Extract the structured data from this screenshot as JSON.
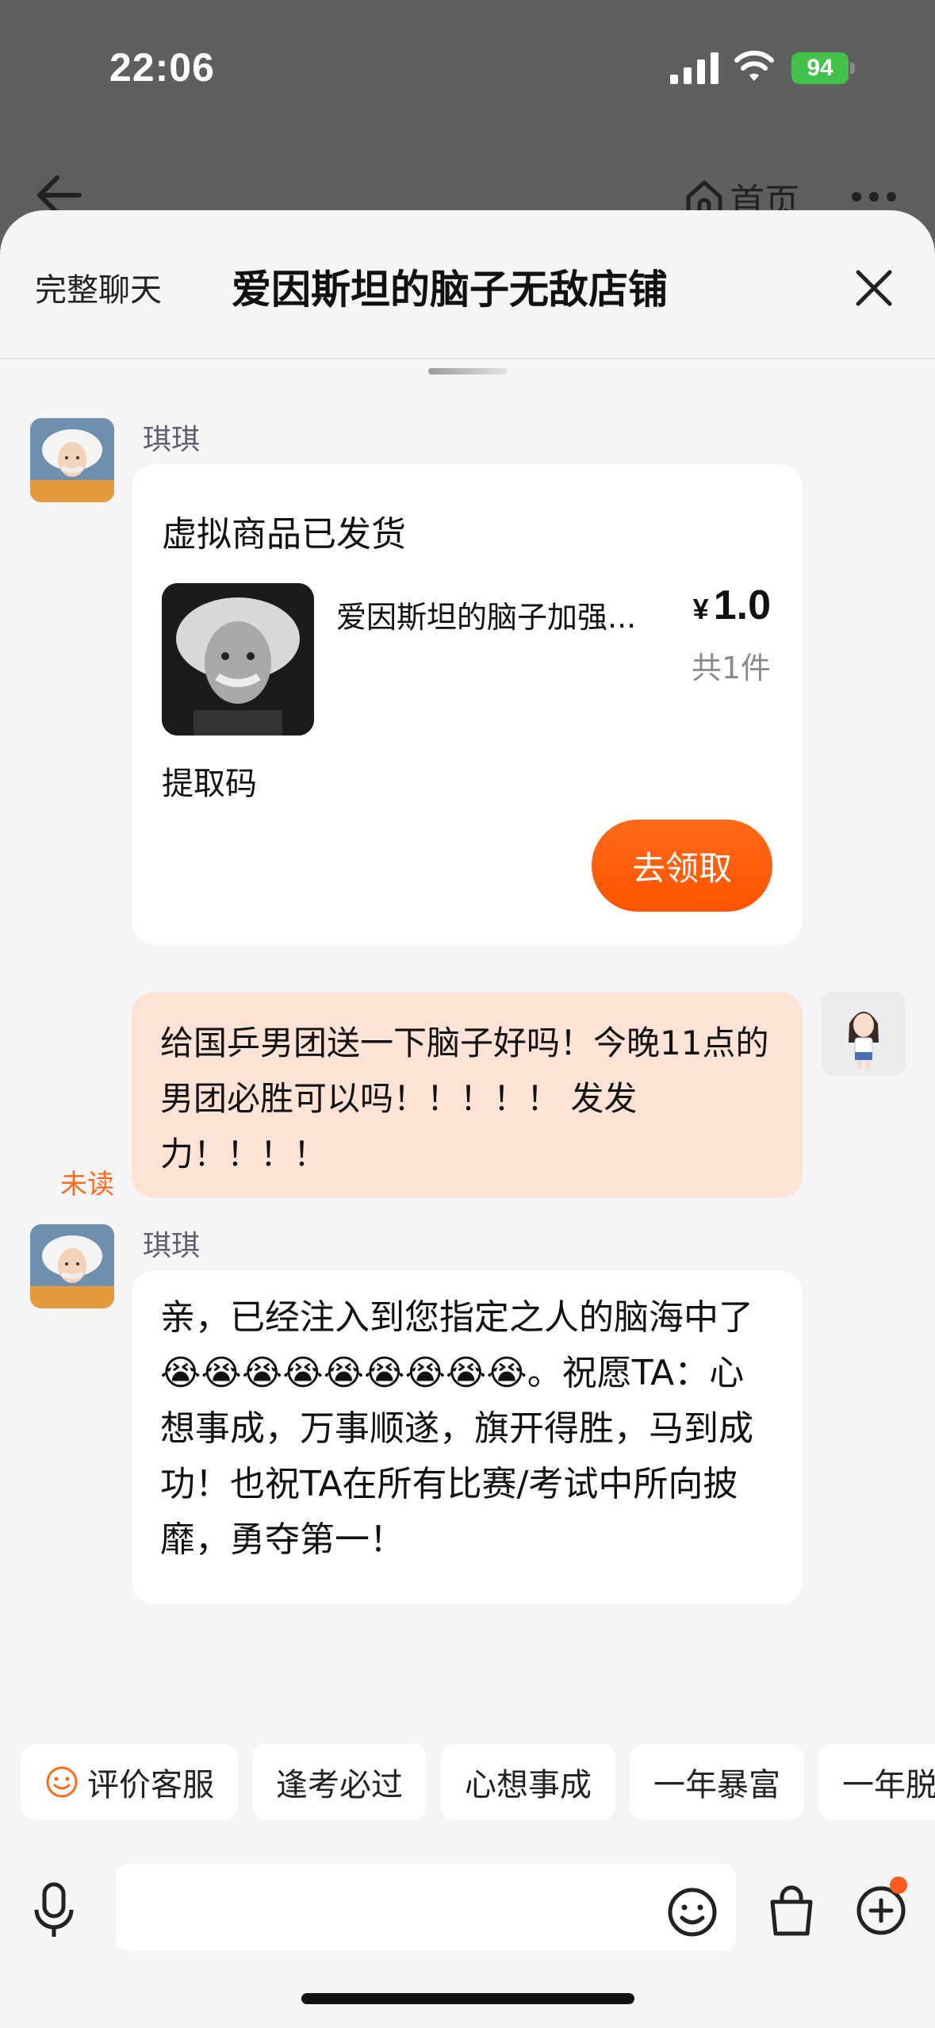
{
  "status_bar": {
    "time": "22:06",
    "battery": "94"
  },
  "nav": {
    "home_label": "首页"
  },
  "sheet": {
    "full_chat_label": "完整聊天",
    "title": "爱因斯坦的脑子无敌店铺"
  },
  "messages": {
    "m1": {
      "sender": "琪琪",
      "card_title": "虚拟商品已发货",
      "product_name": "爱因斯坦的脑子加强...",
      "currency": "¥",
      "price": "1.0",
      "quantity": "共1件",
      "code_label": "提取码",
      "claim_button": "去领取"
    },
    "m2": {
      "text": "给国乒男团送一下脑子好吗！今晚11点的男团必胜可以吗！！！！！ 发发力！！！！",
      "status": "未读"
    },
    "m3": {
      "sender": "琪琪",
      "text_before": "亲，已经注入到您指定之人的脑海中了",
      "emoji": "😭😭😭😭😭😭😭😭😭",
      "text_after": "。祝愿TA：心想事成，万事顺遂，旗开得胜，马到成功！也祝TA在所有比赛/考试中所向披靡，勇夺第一！"
    }
  },
  "quick_replies": [
    "评价客服",
    "逢考必过",
    "心想事成",
    "一年暴富",
    "一年脱"
  ],
  "colors": {
    "accent": "#ff5a00",
    "out_bubble": "#fde3d6",
    "battery": "#42c24a"
  }
}
